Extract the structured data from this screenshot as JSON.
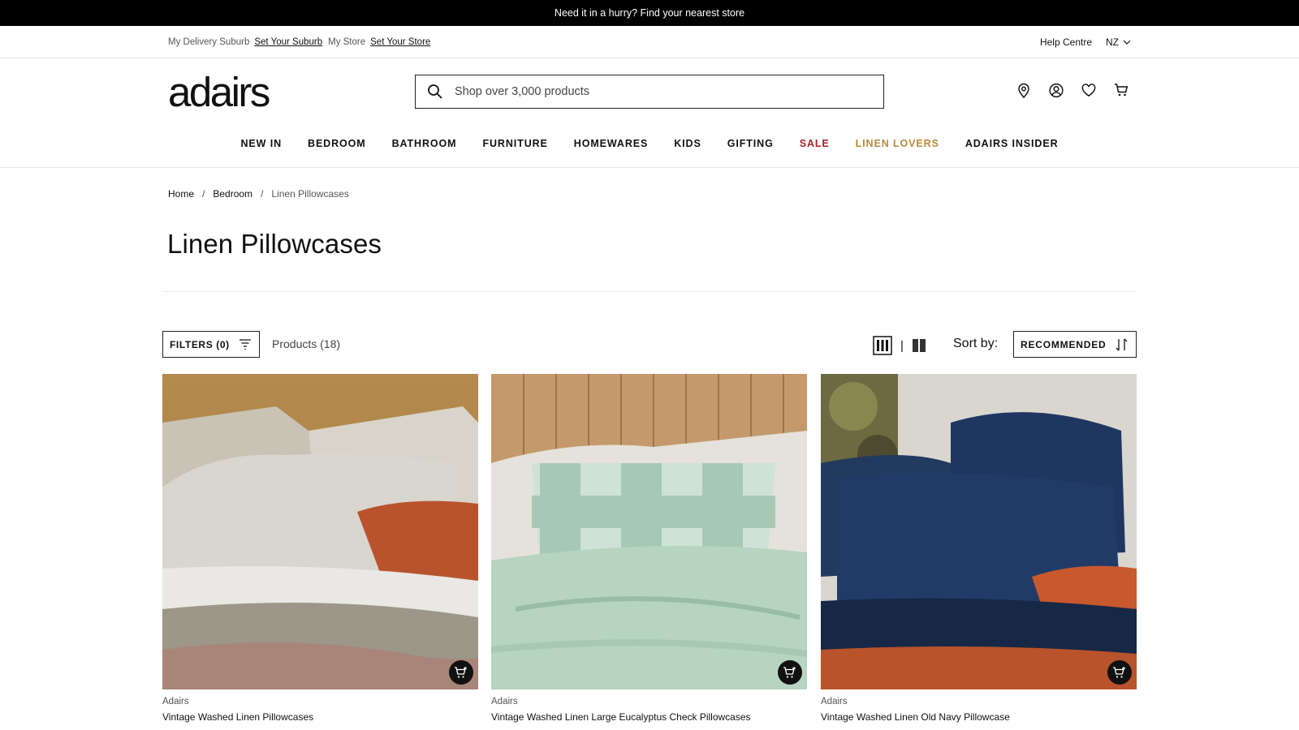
{
  "announcement": "Need it in a hurry? Find your nearest store",
  "utility": {
    "delivery_label": "My Delivery Suburb",
    "delivery_link": "Set Your Suburb",
    "store_label": "My Store",
    "store_link": "Set Your Store",
    "help": "Help Centre",
    "country": "NZ"
  },
  "logo": "adairs",
  "search": {
    "placeholder": "Shop over 3,000 products"
  },
  "nav": [
    "NEW IN",
    "BEDROOM",
    "BATHROOM",
    "FURNITURE",
    "HOMEWARES",
    "KIDS",
    "GIFTING",
    "SALE",
    "LINEN LOVERS",
    "ADAIRS INSIDER"
  ],
  "breadcrumb": [
    "Home",
    "Bedroom",
    "Linen Pillowcases"
  ],
  "title": "Linen Pillowcases",
  "toolbar": {
    "filters": "FILTERS (0)",
    "count": "Products (18)",
    "pipe": "|",
    "sort_label": "Sort by:",
    "sort_value": "RECOMMENDED"
  },
  "products": [
    {
      "brand": "Adairs",
      "name": "Vintage Washed Linen Pillowcases"
    },
    {
      "brand": "Adairs",
      "name": "Vintage Washed Linen Large Eucalyptus Check Pillowcases"
    },
    {
      "brand": "Adairs",
      "name": "Vintage Washed Linen Old Navy Pillowcase"
    }
  ],
  "colors": {
    "sale": "#a8202a",
    "linen_lovers": "#b88a3c",
    "announcement_bg": "#000000"
  }
}
